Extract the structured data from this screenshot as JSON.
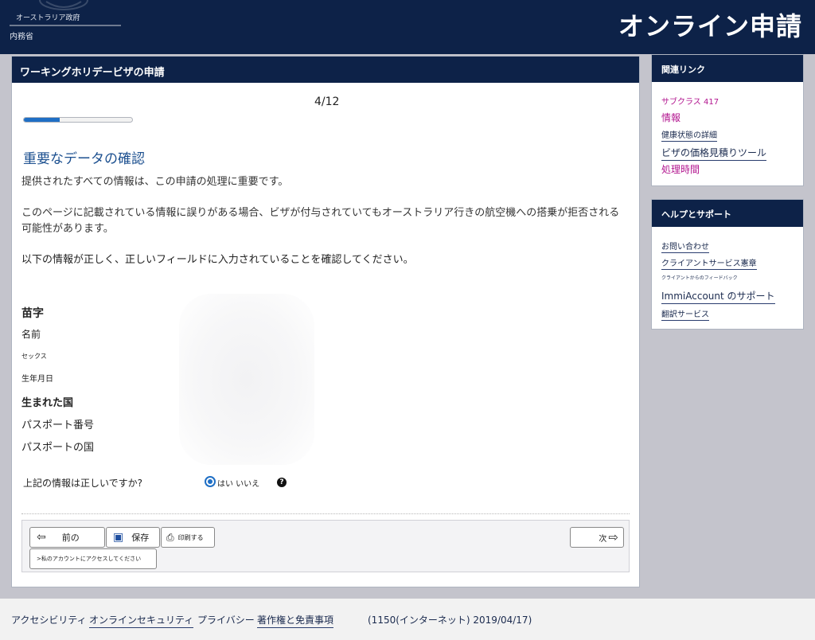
{
  "header": {
    "gov_name": "オーストラリア政府",
    "dept_name": "内務省",
    "app_title": "オンライン申請"
  },
  "main": {
    "panel_title": "ワーキングホリデービザの申請",
    "step": "4/12",
    "progress_fraction": 0.33,
    "section_title": "重要なデータの確認",
    "para1": "提供されたすべての情報は、この申請の処理に重要です。",
    "para2_line1": "このページに記載されている情報に誤りがある場合、ビザが付与されていてもオーストラリア行きの航空機への搭乗が拒否される",
    "para2_line2": "可能性があります。",
    "para3": "以下の情報が正しく、正しいフィールドに入力されていることを確認してください。",
    "fields": {
      "surname": "苗字",
      "given_name": "名前",
      "sex": "セックス",
      "dob": "生年月日",
      "birth_country": "生まれた国",
      "passport_number": "パスポート番号",
      "passport_country": "パスポートの国"
    },
    "question": "上記の情報は正しいですか?",
    "radio_label": "はい いいえ",
    "help_glyph": "?",
    "buttons": {
      "prev": "前の",
      "save": "保存",
      "print": "印刷する",
      "next": "次",
      "account": ">私のアカウントにアクセスしてください"
    },
    "icons": {
      "prev": "arrow-left-icon",
      "save": "floppy-disk-icon",
      "print": "printer-icon",
      "next": "arrow-right-icon"
    }
  },
  "sidebar": {
    "related_title": "関連リンク",
    "related_links": [
      "サブクラス 417",
      "情報",
      "健康状態の詳細",
      "ビザの価格見積りツール",
      "処理時間"
    ],
    "help_title": "ヘルプとサポート",
    "help_links": [
      "お問い合わせ",
      "クライアントサービス憲章",
      "クライアントからのフィードバック",
      "ImmiAccount のサポート",
      "翻訳サービス"
    ]
  },
  "footer": {
    "links": [
      "アクセシビリティ",
      "オンラインセキュリティ",
      "プライバシー",
      "著作権と免責事項"
    ],
    "info": "(1150(インターネット) 2019/04/17)"
  },
  "colors": {
    "navy": "#0d2248",
    "accent_blue": "#1f6fc5",
    "link_pink": "#b2158f"
  }
}
